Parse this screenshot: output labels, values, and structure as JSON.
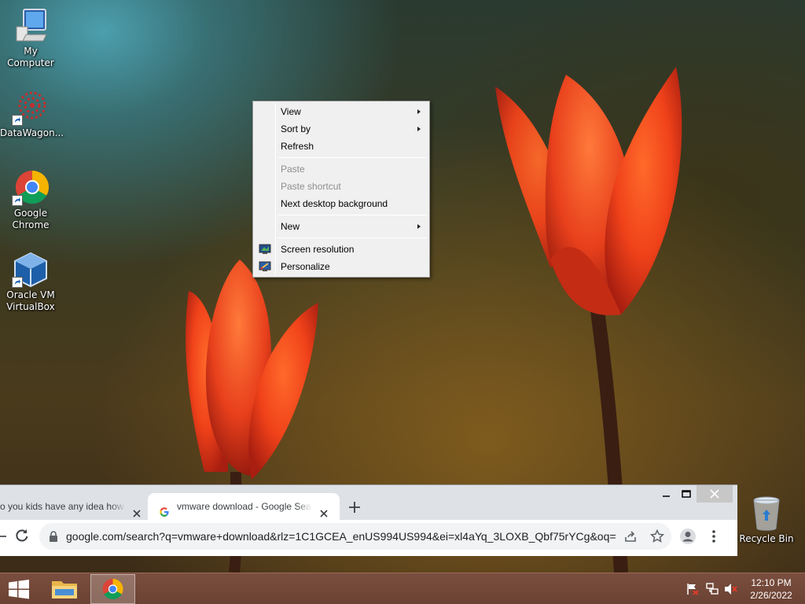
{
  "desktop": {
    "icons": [
      {
        "label": "My Computer",
        "icon": "computer-icon"
      },
      {
        "label": "DataWagon...",
        "icon": "datawagon-icon"
      },
      {
        "label": "Google Chrome",
        "icon": "chrome-icon"
      },
      {
        "label": "Oracle VM VirtualBox",
        "icon": "virtualbox-icon"
      },
      {
        "label": "Recycle Bin",
        "icon": "recycle-bin-icon"
      }
    ]
  },
  "context_menu": {
    "items": [
      {
        "label": "View",
        "submenu": true,
        "enabled": true
      },
      {
        "label": "Sort by",
        "submenu": true,
        "enabled": true
      },
      {
        "label": "Refresh",
        "submenu": false,
        "enabled": true
      },
      {
        "label": "Paste",
        "submenu": false,
        "enabled": false
      },
      {
        "label": "Paste shortcut",
        "submenu": false,
        "enabled": false
      },
      {
        "label": "Next desktop background",
        "submenu": false,
        "enabled": true
      },
      {
        "label": "New",
        "submenu": true,
        "enabled": true
      },
      {
        "label": "Screen resolution",
        "submenu": false,
        "enabled": true,
        "icon": "screen-resolution-icon"
      },
      {
        "label": "Personalize",
        "submenu": false,
        "enabled": true,
        "icon": "personalize-icon"
      }
    ]
  },
  "browser": {
    "tabs": [
      {
        "title": "o you kids have any idea how t"
      },
      {
        "title": "vmware download - Google Sear",
        "active": true
      }
    ],
    "url": "google.com/search?q=vmware+download&rlz=1C1GCEA_enUS994US994&ei=xl4aYq_3LOXB_Qbf75rYCg&oq=v..."
  },
  "taskbar": {
    "clock_time": "12:10 PM",
    "clock_date": "2/26/2022"
  },
  "colors": {
    "taskbar": "#6b4233",
    "menu_bg": "#f0f0f0",
    "chrome_frame": "#dee1e6"
  }
}
